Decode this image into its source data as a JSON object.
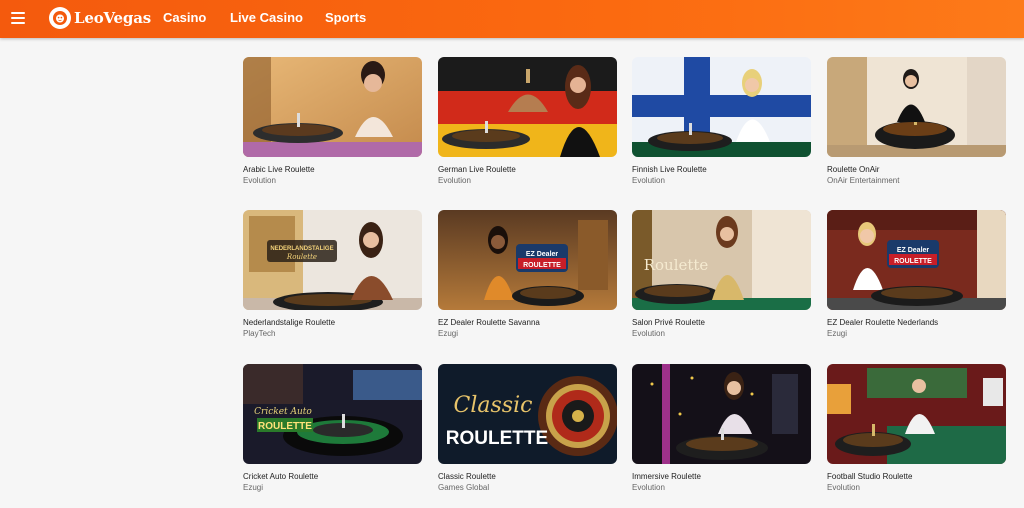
{
  "header": {
    "logo_text": "LeoVegas",
    "nav": [
      "Casino",
      "Live Casino",
      "Sports"
    ]
  },
  "colors": {
    "brand": "#fb6a10",
    "background": "#f6f6f6"
  },
  "games": [
    {
      "title": "Arabic Live Roulette",
      "provider": "Evolution",
      "icon": "dealer-roulette-thumbnail"
    },
    {
      "title": "German Live Roulette",
      "provider": "Evolution",
      "icon": "dealer-roulette-thumbnail"
    },
    {
      "title": "Finnish Live Roulette",
      "provider": "Evolution",
      "icon": "dealer-roulette-thumbnail"
    },
    {
      "title": "Roulette OnAir",
      "provider": "OnAir Entertainment",
      "icon": "dealer-roulette-thumbnail"
    },
    {
      "title": "Nederlandstalige Roulette",
      "provider": "PlayTech",
      "icon": "dealer-roulette-thumbnail",
      "overlay": "NEDERLANDSTALIGE Roulette"
    },
    {
      "title": "EZ Dealer Roulette Savanna",
      "provider": "Ezugi",
      "icon": "dealer-roulette-thumbnail",
      "overlay": "EZ Dealer ROULETTE"
    },
    {
      "title": "Salon Privé Roulette",
      "provider": "Evolution",
      "icon": "dealer-roulette-thumbnail",
      "overlay": "Roulette"
    },
    {
      "title": "EZ Dealer Roulette Nederlands",
      "provider": "Ezugi",
      "icon": "dealer-roulette-thumbnail",
      "overlay": "EZ Dealer ROULETTE"
    },
    {
      "title": "Cricket Auto Roulette",
      "provider": "Ezugi",
      "icon": "auto-roulette-thumbnail",
      "overlay": "Cricket Auto ROULETTE"
    },
    {
      "title": "Classic Roulette",
      "provider": "Games Global",
      "icon": "roulette-wheel-thumbnail",
      "overlay": "ROULETTE"
    },
    {
      "title": "Immersive Roulette",
      "provider": "Evolution",
      "icon": "dealer-roulette-thumbnail"
    },
    {
      "title": "Football Studio Roulette",
      "provider": "Evolution",
      "icon": "dealer-roulette-thumbnail"
    }
  ]
}
